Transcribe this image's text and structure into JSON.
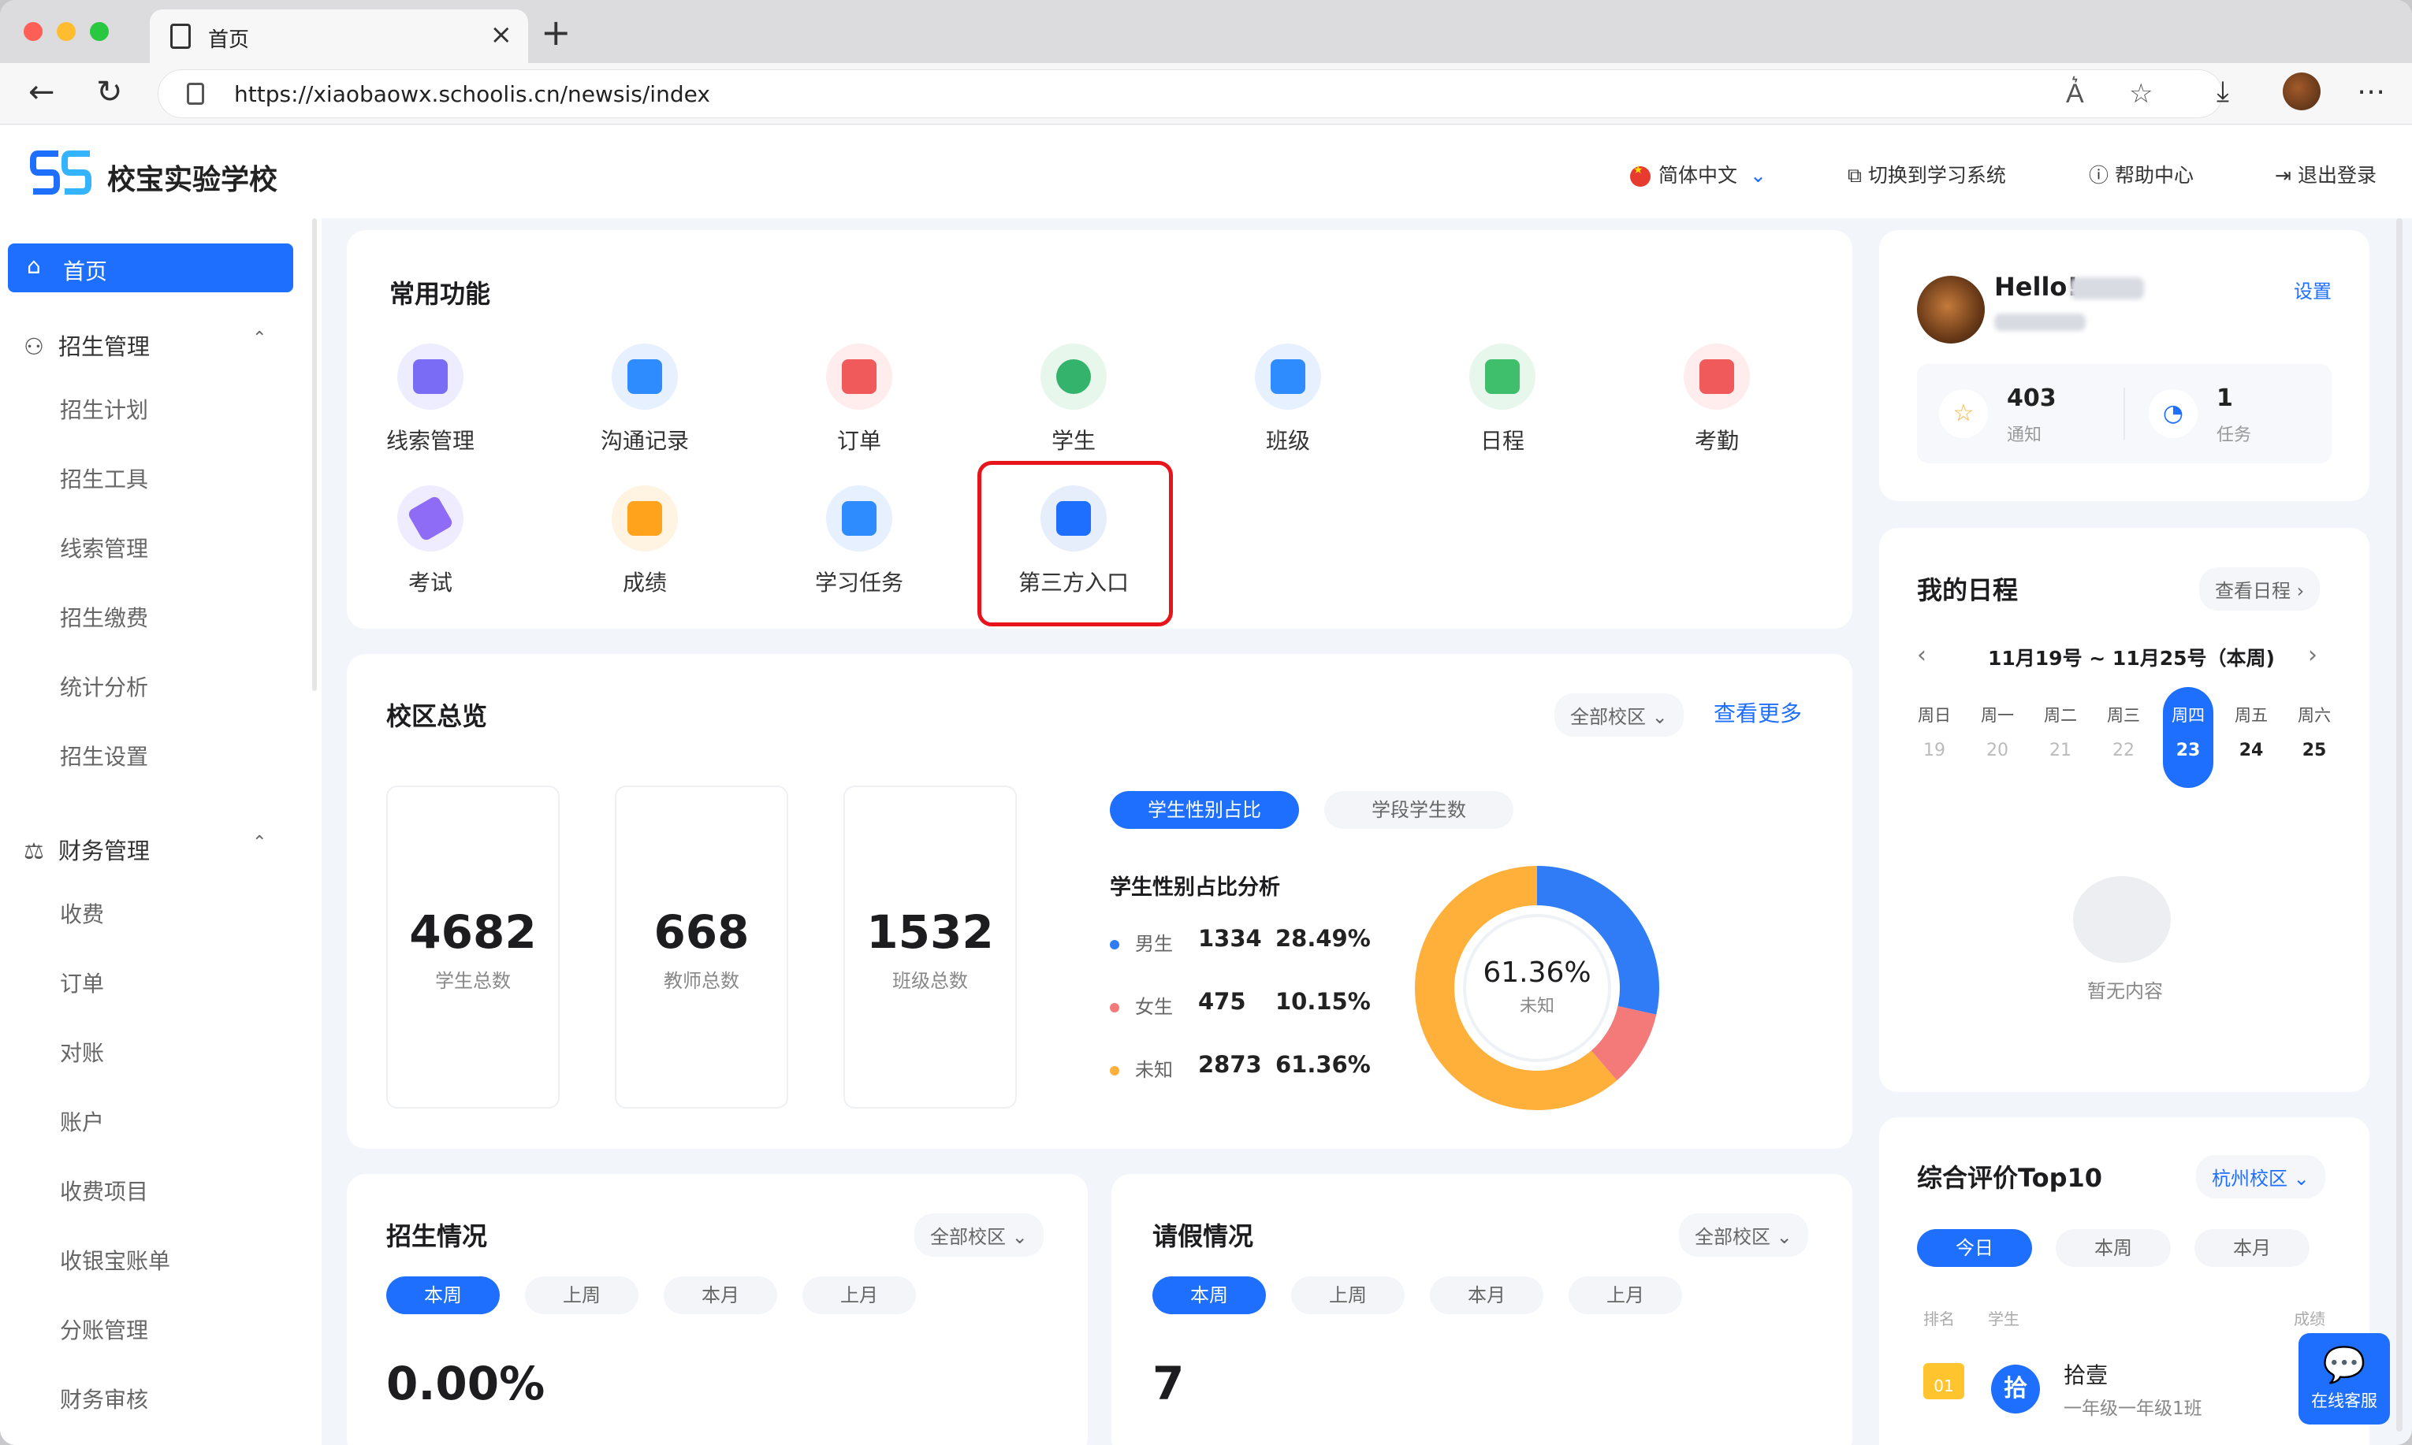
{
  "browser": {
    "tab_title": "首页",
    "url": "https://xiaobaowx.schoolis.cn/newsis/index",
    "colors": {
      "close": "#ff5f57",
      "minimize": "#febc2e",
      "zoom": "#28c840"
    }
  },
  "header": {
    "school_name": "校宝实验学校",
    "language": "简体中文",
    "switch_system": "切换到学习系统",
    "help": "帮助中心",
    "logout": "退出登录"
  },
  "sidebar": {
    "home": "首页",
    "groups": [
      {
        "label": "招生管理",
        "items": [
          "招生计划",
          "招生工具",
          "线索管理",
          "招生缴费",
          "统计分析",
          "招生设置"
        ]
      },
      {
        "label": "财务管理",
        "items": [
          "收费",
          "订单",
          "对账",
          "账户",
          "收费项目",
          "收银宝账单",
          "分账管理",
          "财务审核"
        ]
      }
    ]
  },
  "common_functions": {
    "title": "常用功能",
    "items": [
      {
        "label": "线索管理",
        "icon": "folder-icon",
        "color": "#7b6cf6"
      },
      {
        "label": "沟通记录",
        "icon": "chat-record-icon",
        "color": "#2f8cff"
      },
      {
        "label": "订单",
        "icon": "order-icon",
        "color": "#f05a5a"
      },
      {
        "label": "学生",
        "icon": "student-icon",
        "color": "#33b36b"
      },
      {
        "label": "班级",
        "icon": "class-icon",
        "color": "#2f8cff"
      },
      {
        "label": "日程",
        "icon": "calendar-icon",
        "color": "#3fbf6c"
      },
      {
        "label": "考勤",
        "icon": "attendance-icon",
        "color": "#f05a5a"
      },
      {
        "label": "考试",
        "icon": "exam-icon",
        "color": "#8f6cf6"
      },
      {
        "label": "成绩",
        "icon": "grade-icon",
        "color": "#ffa21c"
      },
      {
        "label": "学习任务",
        "icon": "task-icon",
        "color": "#2f8cff"
      },
      {
        "label": "第三方入口",
        "icon": "third-party-icon",
        "color": "#1f6fff"
      }
    ]
  },
  "campus_overview": {
    "title": "校区总览",
    "campus_select": "全部校区",
    "more": "查看更多",
    "stats": [
      {
        "value": "4682",
        "label": "学生总数"
      },
      {
        "value": "668",
        "label": "教师总数"
      },
      {
        "value": "1532",
        "label": "班级总数"
      }
    ],
    "tabs": [
      "学生性别占比",
      "学段学生数"
    ],
    "analysis_title": "学生性别占比分析",
    "legend": [
      {
        "label": "男生",
        "count": "1334",
        "pct": "28.49%",
        "color": "#2f7cf6"
      },
      {
        "label": "女生",
        "count": "475",
        "pct": "10.15%",
        "color": "#f47a7a"
      },
      {
        "label": "未知",
        "count": "2873",
        "pct": "61.36%",
        "color": "#ffb03a"
      }
    ],
    "donut_center_value": "61.36%",
    "donut_center_label": "未知"
  },
  "chart_data": {
    "type": "pie",
    "categories": [
      "男生",
      "女生",
      "未知"
    ],
    "values": [
      28.49,
      10.15,
      61.36
    ]
  },
  "enrollment": {
    "title": "招生情况",
    "campus_select": "全部校区",
    "tabs": [
      "本周",
      "上周",
      "本月",
      "上月"
    ],
    "value": "0.00%"
  },
  "leave": {
    "title": "请假情况",
    "campus_select": "全部校区",
    "tabs": [
      "本周",
      "上周",
      "本月",
      "上月"
    ],
    "value": "7"
  },
  "user_card": {
    "hello": "Hello!",
    "settings": "设置",
    "notice_count": "403",
    "notice_label": "通知",
    "task_count": "1",
    "task_label": "任务"
  },
  "schedule": {
    "title": "我的日程",
    "view": "查看日程",
    "range": "11月19号 ~ 11月25号（本周)",
    "weekdays": [
      "周日",
      "周一",
      "周二",
      "周三",
      "周四",
      "周五",
      "周六"
    ],
    "dates": [
      "19",
      "20",
      "21",
      "22",
      "23",
      "24",
      "25"
    ],
    "empty": "暂无内容"
  },
  "top10": {
    "title": "综合评价Top10",
    "campus_select": "杭州校区",
    "tabs": [
      "今日",
      "本周",
      "本月"
    ],
    "headers": [
      "排名",
      "学生",
      "成绩"
    ],
    "rows": [
      {
        "rank": "01",
        "avatar_char": "拾",
        "name": "拾壹",
        "class": "一年级一年级1班"
      }
    ]
  },
  "chat": {
    "label": "在线客服"
  }
}
